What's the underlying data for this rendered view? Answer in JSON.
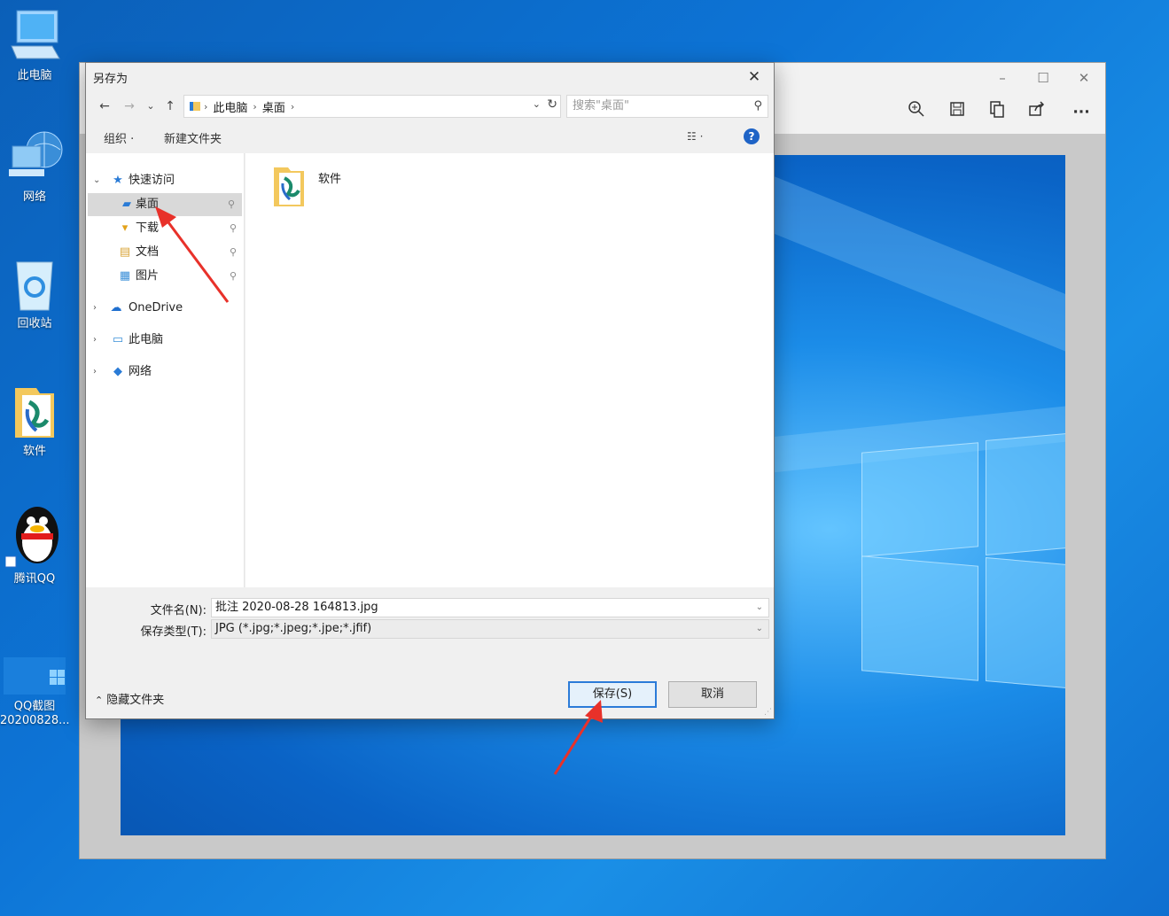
{
  "desktop": {
    "icons": [
      {
        "label": "此电脑"
      },
      {
        "label": "网络"
      },
      {
        "label": "回收站"
      },
      {
        "label": "软件"
      },
      {
        "label": "腾讯QQ"
      },
      {
        "label": "QQ截图\n20200828..."
      }
    ]
  },
  "viewer": {
    "window_buttons": {
      "minimize": "–",
      "maximize": "☐",
      "close": "✕"
    },
    "tools": [
      "zoom-in-icon",
      "save-icon",
      "copy-icon",
      "share-icon",
      "more-icon"
    ],
    "more_label": "···"
  },
  "dialog": {
    "title": "另存为",
    "close": "✕",
    "nav": {
      "back": "←",
      "forward": "→",
      "recent": "⌄",
      "up": "↑"
    },
    "address": {
      "crumbs": [
        "此电脑",
        "桌面"
      ],
      "sep": "›",
      "dropdown": "⌄",
      "refresh": "↻"
    },
    "search": {
      "placeholder": "搜索\"桌面\"",
      "icon": "⚲"
    },
    "commands": {
      "organize": "组织 ·",
      "new_folder": "新建文件夹",
      "view": "☷ ·",
      "help": "?"
    },
    "tree": {
      "quick_access": "快速访问",
      "items": [
        {
          "label": "桌面",
          "selected": true
        },
        {
          "label": "下载"
        },
        {
          "label": "文档"
        },
        {
          "label": "图片"
        }
      ],
      "onedrive": "OneDrive",
      "this_pc": "此电脑",
      "network": "网络",
      "pin": "📌"
    },
    "files": [
      {
        "name": "软件"
      }
    ],
    "filename_label": "文件名(N):",
    "filename_value": "批注 2020-08-28 164813.jpg",
    "filetype_label": "保存类型(T):",
    "filetype_value": "JPG (*.jpg;*.jpeg;*.jpe;*.jfif)",
    "hide_folders": "隐藏文件夹",
    "save_button": "保存(S)",
    "cancel_button": "取消"
  },
  "colors": {
    "accent": "#2b7bd8",
    "annotation_arrow": "#e8312a"
  }
}
